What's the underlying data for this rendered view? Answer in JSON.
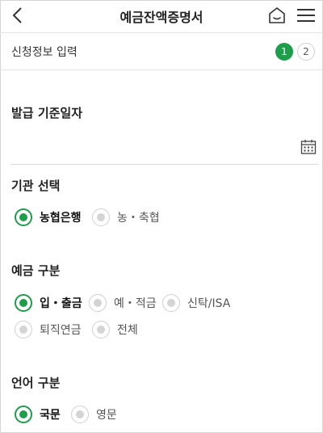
{
  "header": {
    "title": "예금잔액증명서",
    "back_icon": "chevron-left",
    "home_icon": "home",
    "menu_icon": "hamburger-menu"
  },
  "steps": {
    "label": "신청정보 입력",
    "items": [
      "1",
      "2"
    ],
    "current": "1"
  },
  "issue_date": {
    "title": "발급 기준일자",
    "value": "",
    "calendar_icon": "calendar"
  },
  "institution": {
    "title": "기관 선택",
    "options": [
      "농협은행",
      "농・축협"
    ],
    "selected": "농협은행"
  },
  "deposit_type": {
    "title": "예금 구분",
    "options": [
      "입・출금",
      "예・적금",
      "신탁/ISA",
      "퇴직연금",
      "전체"
    ],
    "selected": "입・출금"
  },
  "language": {
    "title": "언어 구분",
    "options": [
      "국문",
      "영문"
    ],
    "selected": "국문"
  },
  "colors": {
    "accent": "#1e9e4a",
    "inactive_dot": "#d4d4d4",
    "divider": "#e4e4e4"
  }
}
